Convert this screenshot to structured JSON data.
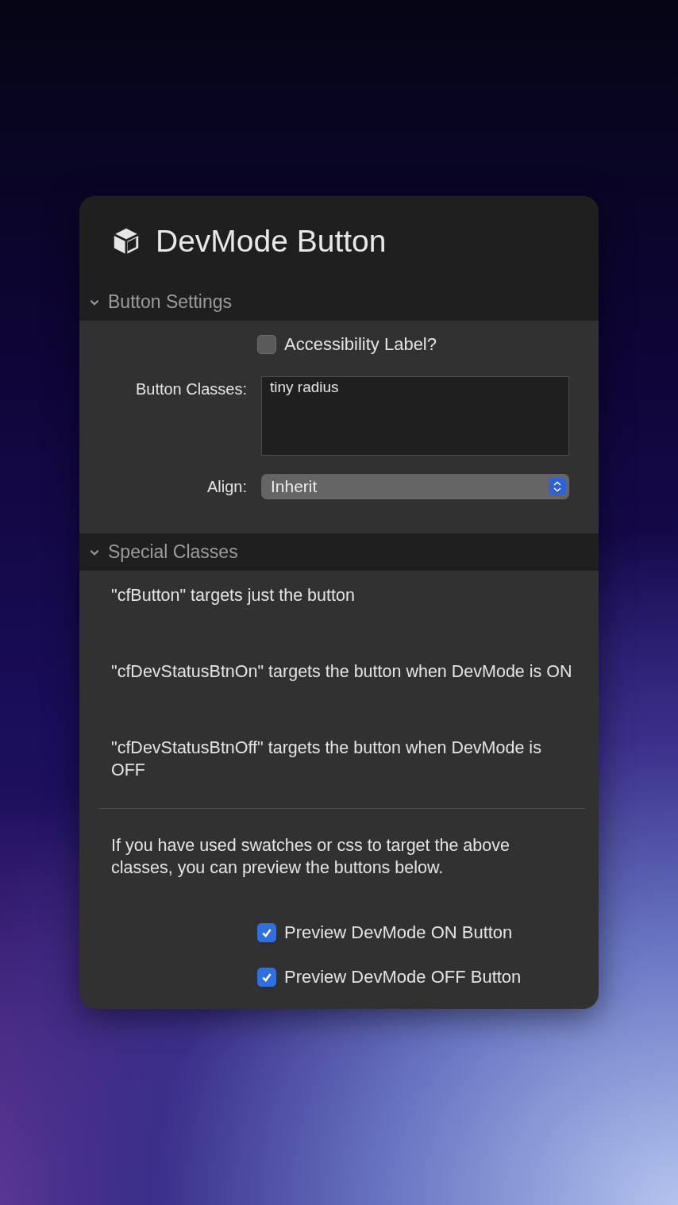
{
  "panel": {
    "title": "DevMode Button"
  },
  "sections": [
    {
      "title": "Button Settings",
      "expanded": true
    },
    {
      "title": "Special Classes",
      "expanded": true
    }
  ],
  "settings": {
    "accessibility": {
      "label": "Accessibility Label?",
      "checked": false
    },
    "classes": {
      "label": "Button Classes:",
      "value": "tiny radius"
    },
    "align": {
      "label": "Align:",
      "value": "Inherit"
    }
  },
  "special": {
    "notes": [
      "\"cfButton\" targets just the button",
      "\"cfDevStatusBtnOn\" targets the button when DevMode is ON",
      "\"cfDevStatusBtnOff\" targets the button when DevMode is OFF"
    ],
    "explanation": "If you have used swatches or css to target the above classes, you can preview the buttons below.",
    "previews": [
      {
        "label": "Preview DevMode ON Button",
        "checked": true
      },
      {
        "label": "Preview DevMode OFF Button",
        "checked": true
      }
    ]
  }
}
